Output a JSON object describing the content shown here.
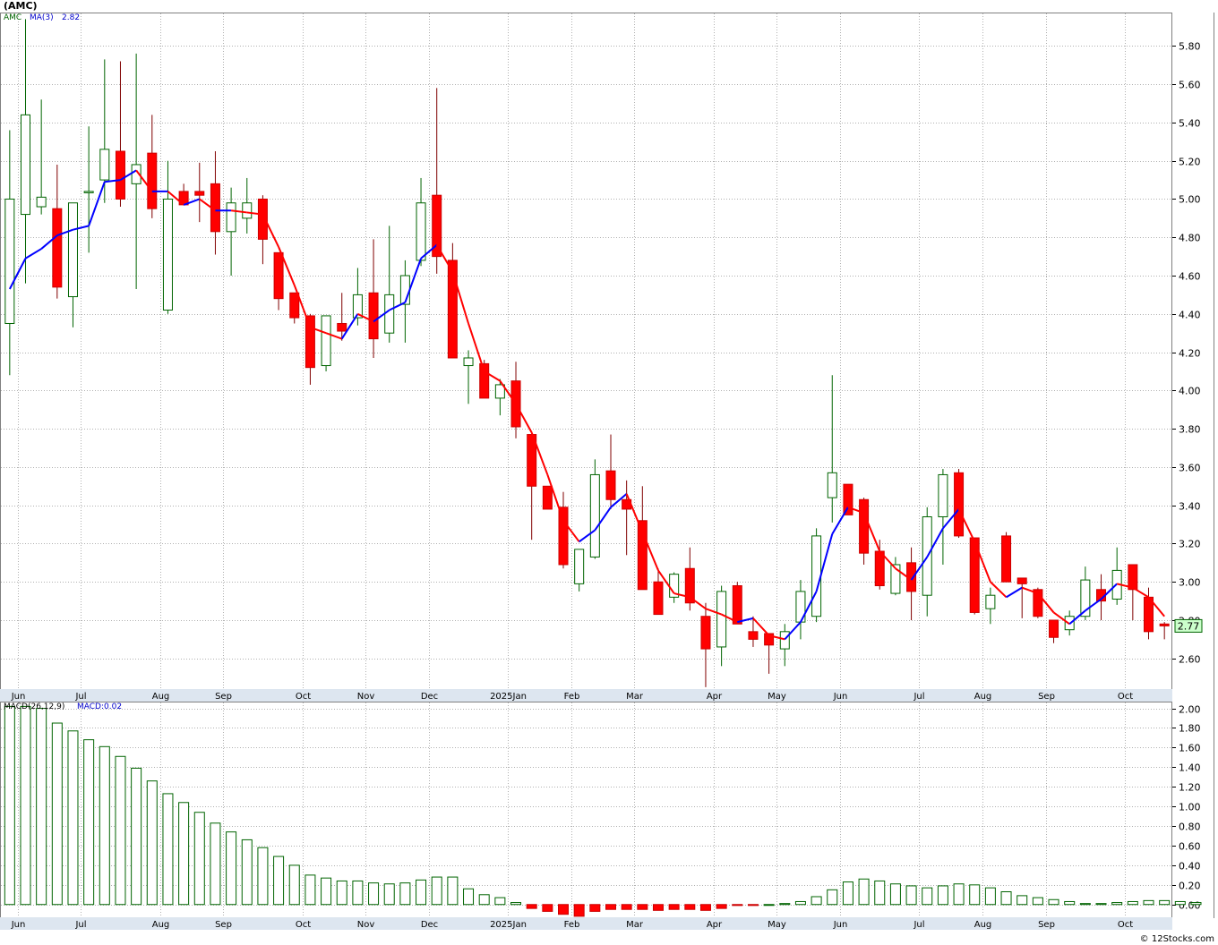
{
  "title": "(AMC)",
  "legend_top": {
    "symbol": "AMC",
    "ma_label": "MA(3)",
    "ma_value": "2.82"
  },
  "legend_bottom": {
    "macd_label": "MACD(26,12,9)",
    "macd_value": "MACD:0.02"
  },
  "last_price_badge": "2.77",
  "copyright": "© 12Stocks.com",
  "colors": {
    "up": "#ffffff",
    "up_border": "#006400",
    "down": "#ff0000",
    "ma_up": "#0000ff",
    "ma_down": "#ff0000",
    "grid": "#b0b0b0",
    "axis_band": "#dde6f0",
    "macd_pos": "#006400",
    "macd_neg": "#ff0000"
  },
  "chart_data": [
    {
      "type": "candlestick",
      "ylim": [
        2.44,
        5.97
      ],
      "yticks": [
        "5.80",
        "5.60",
        "5.40",
        "5.20",
        "5.00",
        "4.80",
        "4.60",
        "4.40",
        "4.20",
        "4.00",
        "3.80",
        "3.60",
        "3.40",
        "3.20",
        "3.00",
        "2.80",
        "2.60"
      ],
      "xticks": [
        "Jun",
        "Jul",
        "Aug",
        "Sep",
        "Oct",
        "Nov",
        "Dec",
        "2025Jan",
        "Feb",
        "Mar",
        "Apr",
        "May",
        "Jun",
        "Jul",
        "Aug",
        "Sep",
        "Oct"
      ],
      "xtick_index": [
        1,
        5,
        10,
        14,
        19,
        23,
        27,
        32,
        36,
        40,
        45,
        49,
        53,
        58,
        62,
        66,
        71
      ],
      "series": [
        {
          "name": "MA(3)",
          "ohlc": [
            [
              4.35,
              5.36,
              4.08,
              5.0
            ],
            [
              4.92,
              5.94,
              4.56,
              5.44
            ],
            [
              4.96,
              5.52,
              4.92,
              5.01
            ],
            [
              4.95,
              5.18,
              4.48,
              4.54
            ],
            [
              4.49,
              4.98,
              4.33,
              4.98
            ],
            [
              5.04,
              5.38,
              4.72,
              5.04
            ],
            [
              5.1,
              5.73,
              4.98,
              5.26
            ],
            [
              5.25,
              5.72,
              4.96,
              5.0
            ],
            [
              5.08,
              5.76,
              4.53,
              5.18
            ],
            [
              5.24,
              5.44,
              4.9,
              4.95
            ],
            [
              4.42,
              5.2,
              4.4,
              5.0
            ],
            [
              5.04,
              5.08,
              4.98,
              4.97
            ],
            [
              5.04,
              5.19,
              4.88,
              5.02
            ],
            [
              5.08,
              5.25,
              4.71,
              4.83
            ],
            [
              4.83,
              5.06,
              4.6,
              4.98
            ],
            [
              4.9,
              5.11,
              4.82,
              4.98
            ],
            [
              5.0,
              5.02,
              4.66,
              4.79
            ],
            [
              4.72,
              4.71,
              4.42,
              4.48
            ],
            [
              4.51,
              4.51,
              4.35,
              4.38
            ],
            [
              4.39,
              4.4,
              4.03,
              4.12
            ],
            [
              4.13,
              4.39,
              4.1,
              4.39
            ],
            [
              4.35,
              4.51,
              4.26,
              4.31
            ],
            [
              4.38,
              4.64,
              4.34,
              4.5
            ],
            [
              4.51,
              4.79,
              4.17,
              4.27
            ],
            [
              4.3,
              4.86,
              4.25,
              4.5
            ],
            [
              4.45,
              4.68,
              4.25,
              4.6
            ],
            [
              4.68,
              5.11,
              4.65,
              4.98
            ],
            [
              5.02,
              5.58,
              4.61,
              4.7
            ],
            [
              4.68,
              4.77,
              4.17,
              4.17
            ],
            [
              4.13,
              4.21,
              3.93,
              4.17
            ],
            [
              4.14,
              4.16,
              3.98,
              3.96
            ],
            [
              3.96,
              4.06,
              3.87,
              4.03
            ],
            [
              4.05,
              4.15,
              3.75,
              3.81
            ],
            [
              3.77,
              3.77,
              3.22,
              3.5
            ],
            [
              3.5,
              3.49,
              3.38,
              3.38
            ],
            [
              3.39,
              3.47,
              3.07,
              3.09
            ],
            [
              2.99,
              3.15,
              2.95,
              3.17
            ],
            [
              3.13,
              3.64,
              3.12,
              3.56
            ],
            [
              3.58,
              3.77,
              3.38,
              3.43
            ],
            [
              3.43,
              3.53,
              3.14,
              3.38
            ],
            [
              3.32,
              3.5,
              2.96,
              2.96
            ],
            [
              3.0,
              3.07,
              2.83,
              2.83
            ],
            [
              2.92,
              3.05,
              2.89,
              3.04
            ],
            [
              3.07,
              3.18,
              2.85,
              2.89
            ],
            [
              2.82,
              2.89,
              2.45,
              2.65
            ],
            [
              2.66,
              2.98,
              2.56,
              2.95
            ],
            [
              2.98,
              3.0,
              2.78,
              2.78
            ],
            [
              2.74,
              2.82,
              2.66,
              2.7
            ],
            [
              2.73,
              2.73,
              2.52,
              2.67
            ],
            [
              2.65,
              2.78,
              2.56,
              2.74
            ],
            [
              2.79,
              3.01,
              2.7,
              2.95
            ],
            [
              2.82,
              3.28,
              2.79,
              3.24
            ],
            [
              3.44,
              4.08,
              3.31,
              3.57
            ],
            [
              3.51,
              3.46,
              3.35,
              3.35
            ],
            [
              3.43,
              3.44,
              3.09,
              3.15
            ],
            [
              3.16,
              3.22,
              2.96,
              2.98
            ],
            [
              2.94,
              3.13,
              2.93,
              3.09
            ],
            [
              3.1,
              3.18,
              2.8,
              2.95
            ],
            [
              2.93,
              3.39,
              2.82,
              3.34
            ],
            [
              3.34,
              3.59,
              3.09,
              3.56
            ],
            [
              3.57,
              3.59,
              3.23,
              3.24
            ],
            [
              3.23,
              3.22,
              2.83,
              2.84
            ],
            [
              2.86,
              2.97,
              2.78,
              2.93
            ],
            [
              3.24,
              3.26,
              3.0,
              3.0
            ],
            [
              3.02,
              3.01,
              2.81,
              2.99
            ],
            [
              2.96,
              2.97,
              2.81,
              2.82
            ],
            [
              2.8,
              2.8,
              2.68,
              2.71
            ],
            [
              2.75,
              2.85,
              2.72,
              2.82
            ],
            [
              2.82,
              3.08,
              2.8,
              3.01
            ],
            [
              2.96,
              3.04,
              2.8,
              2.9
            ],
            [
              2.91,
              3.18,
              2.88,
              3.06
            ],
            [
              3.09,
              3.08,
              2.8,
              2.96
            ],
            [
              2.92,
              2.97,
              2.7,
              2.74
            ],
            [
              2.78,
              2.79,
              2.7,
              2.77
            ]
          ],
          "ma": [
            4.53,
            4.69,
            4.74,
            4.81,
            4.84,
            4.86,
            5.09,
            5.1,
            5.15,
            5.04,
            5.04,
            4.97,
            5.0,
            4.94,
            4.94,
            4.93,
            4.92,
            4.75,
            4.55,
            4.33,
            4.3,
            4.27,
            4.4,
            4.36,
            4.42,
            4.46,
            4.69,
            4.76,
            4.62,
            4.35,
            4.1,
            4.05,
            3.93,
            3.78,
            3.56,
            3.32,
            3.21,
            3.27,
            3.39,
            3.46,
            3.26,
            3.06,
            2.94,
            2.92,
            2.86,
            2.83,
            2.79,
            2.81,
            2.72,
            2.7,
            2.79,
            2.95,
            3.25,
            3.39,
            3.36,
            3.16,
            3.07,
            3.01,
            3.13,
            3.28,
            3.38,
            3.21,
            3.0,
            2.92,
            2.97,
            2.94,
            2.84,
            2.78,
            2.85,
            2.91,
            2.99,
            2.97,
            2.92,
            2.82
          ]
        }
      ]
    },
    {
      "type": "bar",
      "ylim": [
        -0.13,
        2.06
      ],
      "yticks": [
        "2.00",
        "1.80",
        "1.60",
        "1.40",
        "1.20",
        "1.00",
        "0.80",
        "0.60",
        "0.40",
        "0.20",
        "0.00"
      ],
      "xticks": [
        "Jun",
        "Jul",
        "Aug",
        "Sep",
        "Oct",
        "Nov",
        "Dec",
        "2025Jan",
        "Feb",
        "Mar",
        "Apr",
        "May",
        "Jun",
        "Jul",
        "Aug",
        "Sep",
        "Oct"
      ],
      "xtick_index": [
        1,
        5,
        10,
        14,
        19,
        23,
        27,
        32,
        36,
        40,
        45,
        49,
        53,
        58,
        62,
        66,
        71
      ],
      "series": [
        {
          "name": "MACD(26,12,9)",
          "values": [
            2.02,
            2.02,
            2.0,
            1.85,
            1.77,
            1.68,
            1.61,
            1.51,
            1.39,
            1.26,
            1.13,
            1.04,
            0.94,
            0.83,
            0.74,
            0.66,
            0.58,
            0.49,
            0.4,
            0.3,
            0.27,
            0.24,
            0.24,
            0.22,
            0.21,
            0.22,
            0.25,
            0.28,
            0.28,
            0.16,
            0.1,
            0.07,
            0.02,
            -0.04,
            -0.07,
            -0.1,
            -0.12,
            -0.07,
            -0.05,
            -0.05,
            -0.05,
            -0.06,
            -0.05,
            -0.05,
            -0.06,
            -0.04,
            -0.01,
            -0.01,
            0.0,
            0.01,
            0.03,
            0.08,
            0.15,
            0.23,
            0.26,
            0.24,
            0.21,
            0.19,
            0.17,
            0.19,
            0.21,
            0.2,
            0.17,
            0.13,
            0.09,
            0.07,
            0.05,
            0.03,
            0.01,
            0.01,
            0.02,
            0.03,
            0.04,
            0.04,
            0.03,
            0.02
          ]
        }
      ]
    }
  ]
}
